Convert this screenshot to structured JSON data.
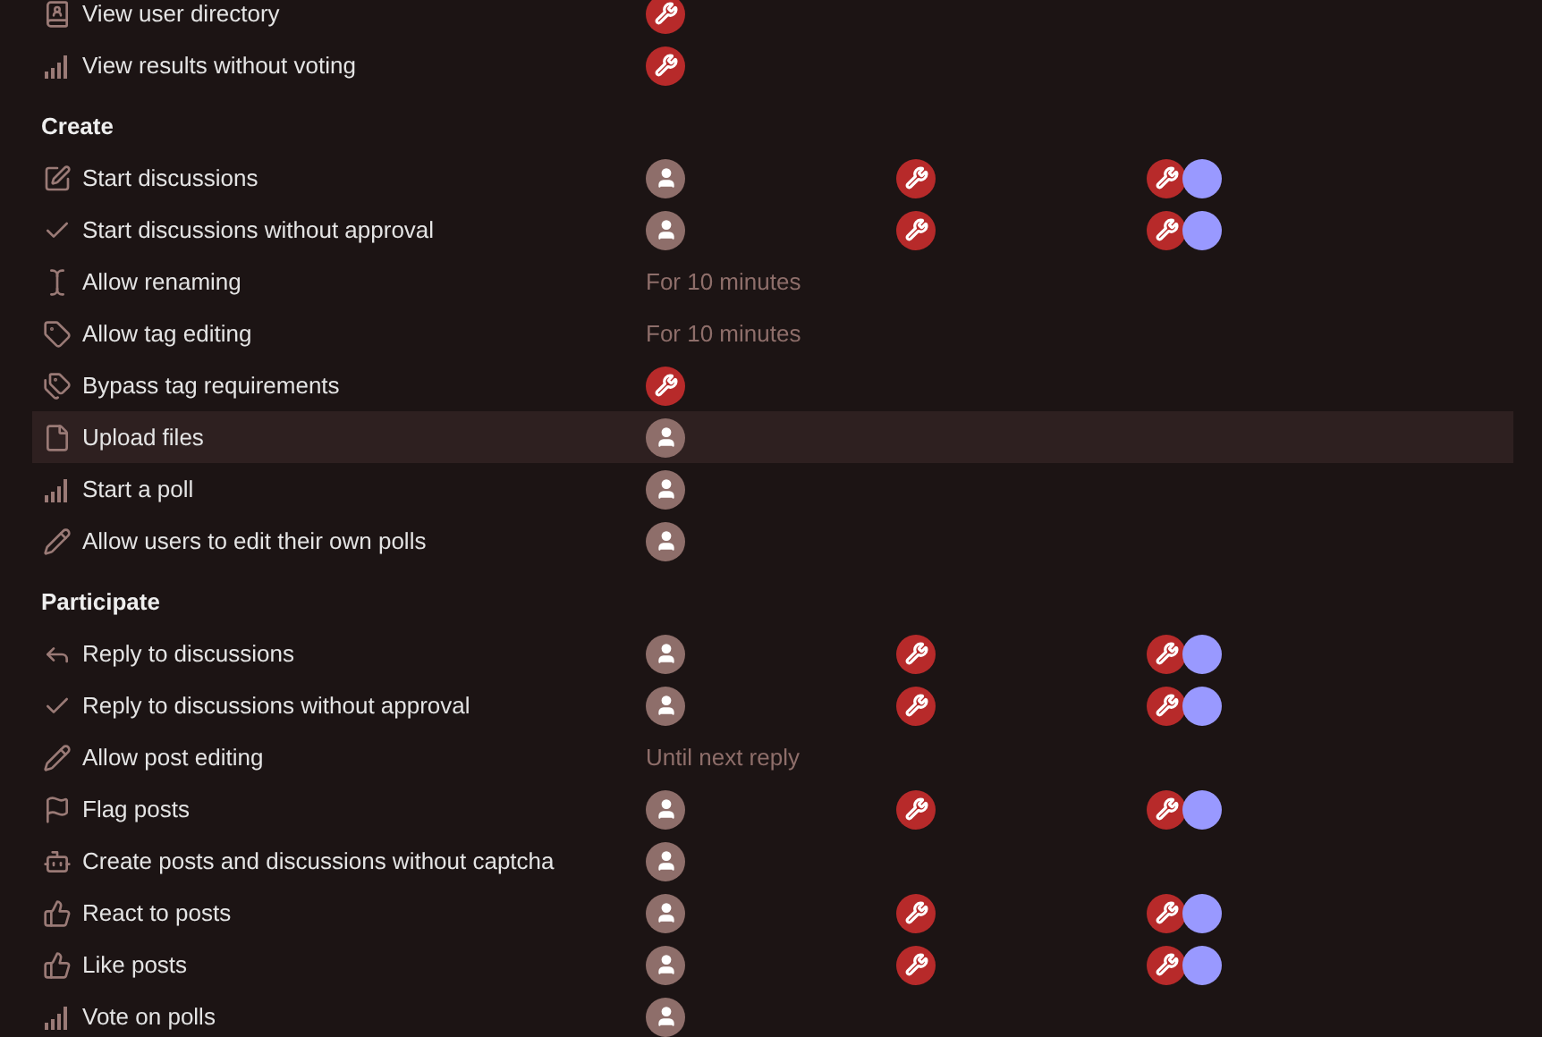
{
  "sections": [
    {
      "rows": [
        {
          "kind": "directory",
          "label": "View user directory",
          "hovered": false,
          "cells": [
            {
              "badges": [
                {
                  "kind": "mod"
                }
              ]
            },
            {},
            {}
          ]
        },
        {
          "kind": "bars",
          "label": "View results without voting",
          "hovered": false,
          "cells": [
            {
              "badges": [
                {
                  "kind": "mod"
                }
              ]
            },
            {},
            {}
          ]
        }
      ]
    },
    {
      "heading": "Create",
      "rows": [
        {
          "kind": "edit",
          "label": "Start discussions",
          "hovered": false,
          "cells": [
            {
              "badges": [
                {
                  "kind": "member"
                }
              ]
            },
            {
              "badges": [
                {
                  "kind": "mod"
                }
              ]
            },
            {
              "badges": [
                {
                  "kind": "mod"
                },
                {
                  "kind": "group"
                }
              ]
            }
          ]
        },
        {
          "kind": "check",
          "label": "Start discussions without approval",
          "hovered": false,
          "cells": [
            {
              "badges": [
                {
                  "kind": "member"
                }
              ]
            },
            {
              "badges": [
                {
                  "kind": "mod"
                }
              ]
            },
            {
              "badges": [
                {
                  "kind": "mod"
                },
                {
                  "kind": "group"
                }
              ]
            }
          ]
        },
        {
          "kind": "cursor",
          "label": "Allow renaming",
          "hovered": false,
          "cells": [
            {
              "text": "For 10 minutes"
            },
            {},
            {}
          ]
        },
        {
          "kind": "tag",
          "label": "Allow tag editing",
          "hovered": false,
          "cells": [
            {
              "text": "For 10 minutes"
            },
            {},
            {}
          ]
        },
        {
          "kind": "tags",
          "label": "Bypass tag requirements",
          "hovered": false,
          "cells": [
            {
              "badges": [
                {
                  "kind": "mod"
                }
              ]
            },
            {},
            {}
          ]
        },
        {
          "kind": "file",
          "label": "Upload files",
          "hovered": true,
          "cells": [
            {
              "badges": [
                {
                  "kind": "member"
                }
              ]
            },
            {},
            {}
          ]
        },
        {
          "kind": "bars",
          "label": "Start a poll",
          "hovered": false,
          "cells": [
            {
              "badges": [
                {
                  "kind": "member"
                }
              ]
            },
            {},
            {}
          ]
        },
        {
          "kind": "pencil",
          "label": "Allow users to edit their own polls",
          "hovered": false,
          "cells": [
            {
              "badges": [
                {
                  "kind": "member"
                }
              ]
            },
            {},
            {}
          ]
        }
      ]
    },
    {
      "heading": "Participate",
      "rows": [
        {
          "kind": "reply",
          "label": "Reply to discussions",
          "hovered": false,
          "cells": [
            {
              "badges": [
                {
                  "kind": "member"
                }
              ]
            },
            {
              "badges": [
                {
                  "kind": "mod"
                }
              ]
            },
            {
              "badges": [
                {
                  "kind": "mod"
                },
                {
                  "kind": "group"
                }
              ]
            }
          ]
        },
        {
          "kind": "check",
          "label": "Reply to discussions without approval",
          "hovered": false,
          "cells": [
            {
              "badges": [
                {
                  "kind": "member"
                }
              ]
            },
            {
              "badges": [
                {
                  "kind": "mod"
                }
              ]
            },
            {
              "badges": [
                {
                  "kind": "mod"
                },
                {
                  "kind": "group"
                }
              ]
            }
          ]
        },
        {
          "kind": "pencil",
          "label": "Allow post editing",
          "hovered": false,
          "cells": [
            {
              "text": "Until next reply"
            },
            {},
            {}
          ]
        },
        {
          "kind": "flag",
          "label": "Flag posts",
          "hovered": false,
          "cells": [
            {
              "badges": [
                {
                  "kind": "member"
                }
              ]
            },
            {
              "badges": [
                {
                  "kind": "mod"
                }
              ]
            },
            {
              "badges": [
                {
                  "kind": "mod"
                },
                {
                  "kind": "group"
                }
              ]
            }
          ]
        },
        {
          "kind": "robot",
          "label": "Create posts and discussions without captcha",
          "hovered": false,
          "cells": [
            {
              "badges": [
                {
                  "kind": "member"
                }
              ]
            },
            {},
            {}
          ]
        },
        {
          "kind": "thumb",
          "label": "React to posts",
          "hovered": false,
          "cells": [
            {
              "badges": [
                {
                  "kind": "member"
                }
              ]
            },
            {
              "badges": [
                {
                  "kind": "mod"
                }
              ]
            },
            {
              "badges": [
                {
                  "kind": "mod"
                },
                {
                  "kind": "group"
                }
              ]
            }
          ]
        },
        {
          "kind": "thumb",
          "label": "Like posts",
          "hovered": false,
          "cells": [
            {
              "badges": [
                {
                  "kind": "member"
                }
              ]
            },
            {
              "badges": [
                {
                  "kind": "mod"
                }
              ]
            },
            {
              "badges": [
                {
                  "kind": "mod"
                },
                {
                  "kind": "group"
                }
              ]
            }
          ]
        },
        {
          "kind": "bars",
          "label": "Vote on polls",
          "hovered": false,
          "cells": [
            {
              "badges": [
                {
                  "kind": "member"
                }
              ]
            },
            {},
            {}
          ]
        }
      ]
    }
  ]
}
